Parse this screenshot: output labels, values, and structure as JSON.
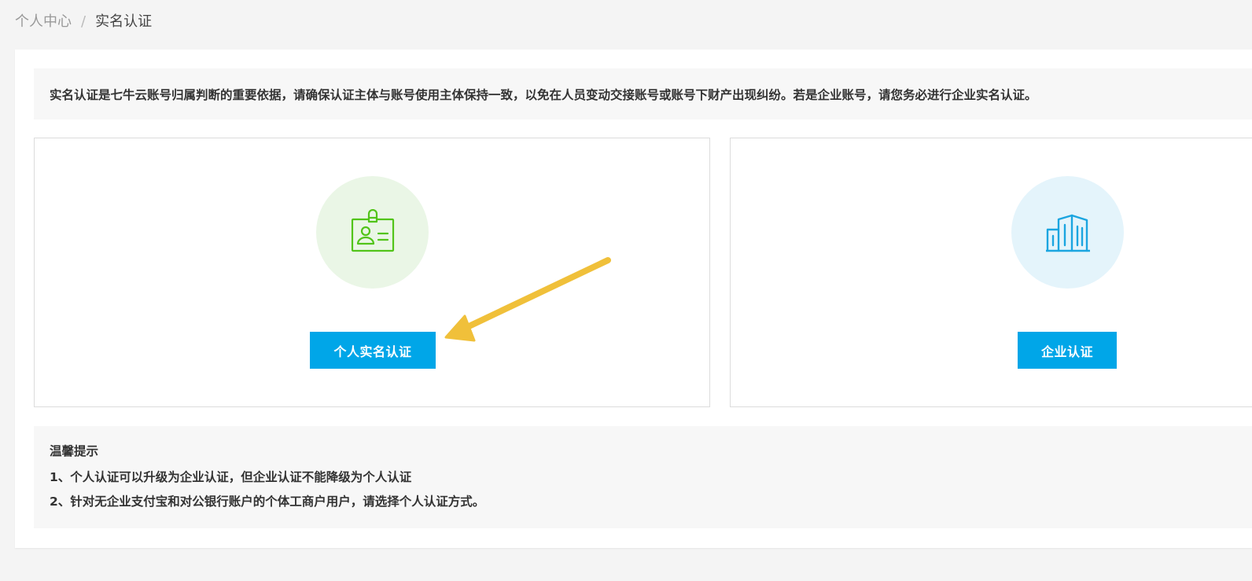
{
  "breadcrumb": {
    "parent": "个人中心",
    "separator": "/",
    "current": "实名认证"
  },
  "notice": {
    "text": "实名认证是七牛云账号归属判断的重要依据，请确保认证主体与账号使用主体保持一致，以免在人员变动交接账号或账号下财产出现纠纷。若是企业账号，请您务必进行企业实名认证。"
  },
  "personal": {
    "icon": "id-card-icon",
    "icon_color": "#52c41a",
    "circle_color": "#eaf6e6",
    "button_label": "个人实名认证"
  },
  "enterprise": {
    "icon": "building-icon",
    "icon_color": "#1ba5e0",
    "circle_color": "#e4f4fb",
    "button_label": "企业认证"
  },
  "tips": {
    "title": "温馨提示",
    "lines": [
      "1、个人认证可以升级为企业认证，但企业认证不能降级为个人认证",
      "2、针对无企业支付宝和对公银行账户的个体工商户用户，请选择个人认证方式。"
    ]
  },
  "colors": {
    "accent": "#00a6e8",
    "annotation_arrow": "#f0c03a"
  }
}
